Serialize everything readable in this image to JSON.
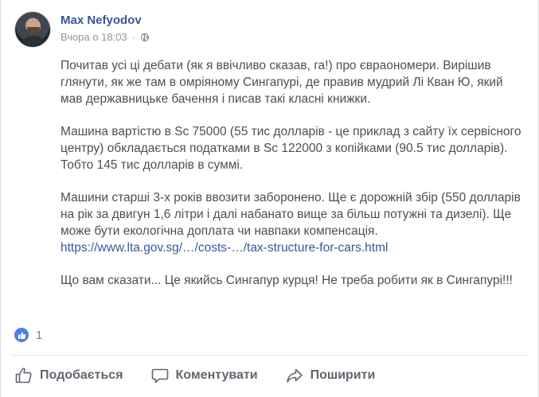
{
  "post": {
    "author": "Max Nefyodov",
    "timestamp": "Вчора о 18:03",
    "separator": "·",
    "privacy_icon": "globe-icon",
    "paragraphs": [
      "Почитав усі ці дебати (як я ввічливо сказав, га!) про євраономери. Вирішив глянути, як же там в омріяному Сингапурі, де правив мудрий Лі Кван Ю, який мав державницьке бачення і писав такі класні книжки.",
      "Машина вартістю в Sc 75000 (55 тис долларів - це приклад з сайту їх сервісного центру) обкладається податками в Sc 122000 з копійками (90.5 тис долларів). Тобто 145 тис долларів в суммі.",
      "Машини старші 3-х років ввозити заборонено. Ще є дорожній збір (550 долларів на рік за двигун 1,6 літри і далі набанато вище за більш потужні та дизелі). Ще може бути екологічна доплата чи навпаки компенсація.",
      "Що вам сказати... Це якийсь Сингапур курця! Не треба робити як в Сингапурі!!!"
    ],
    "link_text": "https://www.lta.gov.sg/…/costs-…/tax-structure-for-cars.html"
  },
  "reactions": {
    "icon": "like-icon",
    "count": "1",
    "color": "#4b7bec"
  },
  "actions": {
    "like_label": "Подобається",
    "comment_label": "Коментувати",
    "share_label": "Поширити"
  },
  "colors": {
    "author": "#365899",
    "meta": "#90949c",
    "text": "#4b4f56",
    "action": "#616770"
  }
}
